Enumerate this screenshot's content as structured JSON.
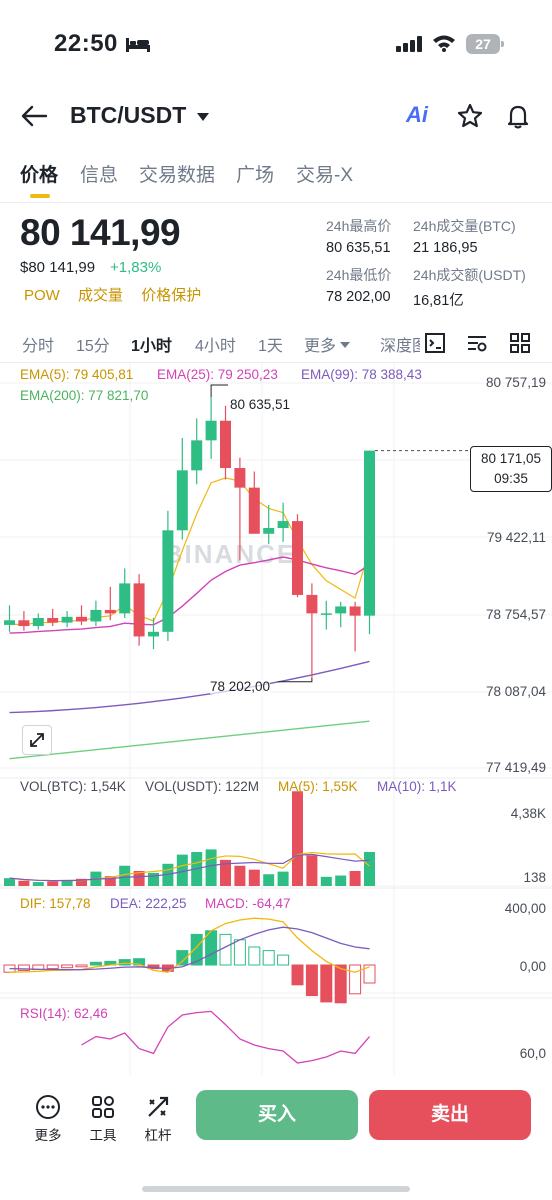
{
  "status_bar": {
    "time": "22:50",
    "battery": "27"
  },
  "header": {
    "pair": "BTC/USDT",
    "ai_label": "Ai"
  },
  "tabs": [
    "价格",
    "信息",
    "交易数据",
    "广场",
    "交易-X"
  ],
  "price": {
    "last": "80 141,99",
    "fiat": "$80 141,99",
    "change": "+1,83%",
    "tags": [
      "POW",
      "成交量",
      "价格保护"
    ]
  },
  "stats": {
    "high_label": "24h最高价",
    "high_value": "80 635,51",
    "vol_btc_label": "24h成交量(BTC)",
    "vol_btc_value": "21 186,95",
    "low_label": "24h最低价",
    "low_value": "78 202,00",
    "vol_usdt_label": "24h成交额(USDT)",
    "vol_usdt_value": "16,81亿"
  },
  "intervals": [
    "分时",
    "15分",
    "1小时",
    "4小时",
    "1天",
    "更多",
    "深度图"
  ],
  "active_interval": "1小时",
  "indicators": {
    "ema5": "EMA(5): 79 405,81",
    "ema25": "EMA(25): 79 250,23",
    "ema99": "EMA(99): 78 388,43",
    "ema200": "EMA(200): 77 821,70",
    "vol_btc": "VOL(BTC): 1,54K",
    "vol_usdt": "VOL(USDT): 122M",
    "ma5": "MA(5): 1,55K",
    "ma10": "MA(10): 1,1K",
    "dif": "DIF: 157,78",
    "dea": "DEA: 222,25",
    "macd": "MACD: -64,47",
    "rsi": "RSI(14): 62,46"
  },
  "colors": {
    "up": "#2ebd85",
    "down": "#e64f5c",
    "ema5": "#f0b90b",
    "ema25": "#d243b8",
    "ema99": "#7b5bbd",
    "ema200": "#6fcf7f"
  },
  "axis": {
    "price_ticks": [
      "80 757,19",
      "79 422,11",
      "78 754,57",
      "78 087,04",
      "77 419,49"
    ],
    "vol_ticks": [
      "4,38K",
      "138"
    ],
    "macd_ticks": [
      "400,00",
      "0,00"
    ],
    "rsi_ticks": [
      "60,0"
    ]
  },
  "price_tag": {
    "price": "80 171,05",
    "countdown": "09:35"
  },
  "markers": {
    "high": "80 635,51",
    "low": "78 202,00"
  },
  "watermark": "BINANCE",
  "chart_data": {
    "type": "candlestick",
    "price_range": [
      77419.49,
      80757.19
    ],
    "candles": [
      {
        "o": 78660,
        "h": 78830,
        "l": 78600,
        "c": 78700
      },
      {
        "o": 78700,
        "h": 78780,
        "l": 78610,
        "c": 78650
      },
      {
        "o": 78650,
        "h": 78760,
        "l": 78620,
        "c": 78720
      },
      {
        "o": 78720,
        "h": 78800,
        "l": 78650,
        "c": 78680
      },
      {
        "o": 78680,
        "h": 78780,
        "l": 78640,
        "c": 78730
      },
      {
        "o": 78730,
        "h": 78830,
        "l": 78660,
        "c": 78690
      },
      {
        "o": 78690,
        "h": 78870,
        "l": 78650,
        "c": 78790
      },
      {
        "o": 78790,
        "h": 78990,
        "l": 78700,
        "c": 78760
      },
      {
        "o": 78760,
        "h": 79150,
        "l": 78720,
        "c": 79020
      },
      {
        "o": 79020,
        "h": 79100,
        "l": 78480,
        "c": 78560
      },
      {
        "o": 78560,
        "h": 78720,
        "l": 78450,
        "c": 78600
      },
      {
        "o": 78600,
        "h": 79650,
        "l": 78520,
        "c": 79480
      },
      {
        "o": 79480,
        "h": 80280,
        "l": 79400,
        "c": 80000
      },
      {
        "o": 80000,
        "h": 80450,
        "l": 79880,
        "c": 80260
      },
      {
        "o": 80260,
        "h": 80635.51,
        "l": 80100,
        "c": 80430
      },
      {
        "o": 80430,
        "h": 80560,
        "l": 79920,
        "c": 80020
      },
      {
        "o": 80020,
        "h": 80110,
        "l": 79220,
        "c": 79850
      },
      {
        "o": 79850,
        "h": 79990,
        "l": 79480,
        "c": 79450
      },
      {
        "o": 79450,
        "h": 79700,
        "l": 79360,
        "c": 79500
      },
      {
        "o": 79500,
        "h": 79720,
        "l": 79380,
        "c": 79560
      },
      {
        "o": 79560,
        "h": 79620,
        "l": 78900,
        "c": 78920
      },
      {
        "o": 78920,
        "h": 79020,
        "l": 78202,
        "c": 78760
      },
      {
        "o": 78760,
        "h": 78870,
        "l": 78620,
        "c": 78760
      },
      {
        "o": 78760,
        "h": 78860,
        "l": 78640,
        "c": 78820
      },
      {
        "o": 78820,
        "h": 78860,
        "l": 78430,
        "c": 78740
      },
      {
        "o": 78740,
        "h": 80171,
        "l": 78580,
        "c": 80171
      }
    ],
    "volume": [
      120,
      80,
      60,
      70,
      90,
      110,
      220,
      150,
      310,
      230,
      200,
      340,
      480,
      520,
      560,
      400,
      310,
      250,
      180,
      220,
      1450,
      470,
      140,
      160,
      230,
      520
    ],
    "macd_hist": [
      -40,
      -30,
      -25,
      -20,
      -15,
      -10,
      15,
      20,
      30,
      35,
      -20,
      -35,
      80,
      170,
      190,
      170,
      140,
      100,
      80,
      55,
      -110,
      -170,
      -205,
      -210,
      -160,
      -100
    ]
  }
}
